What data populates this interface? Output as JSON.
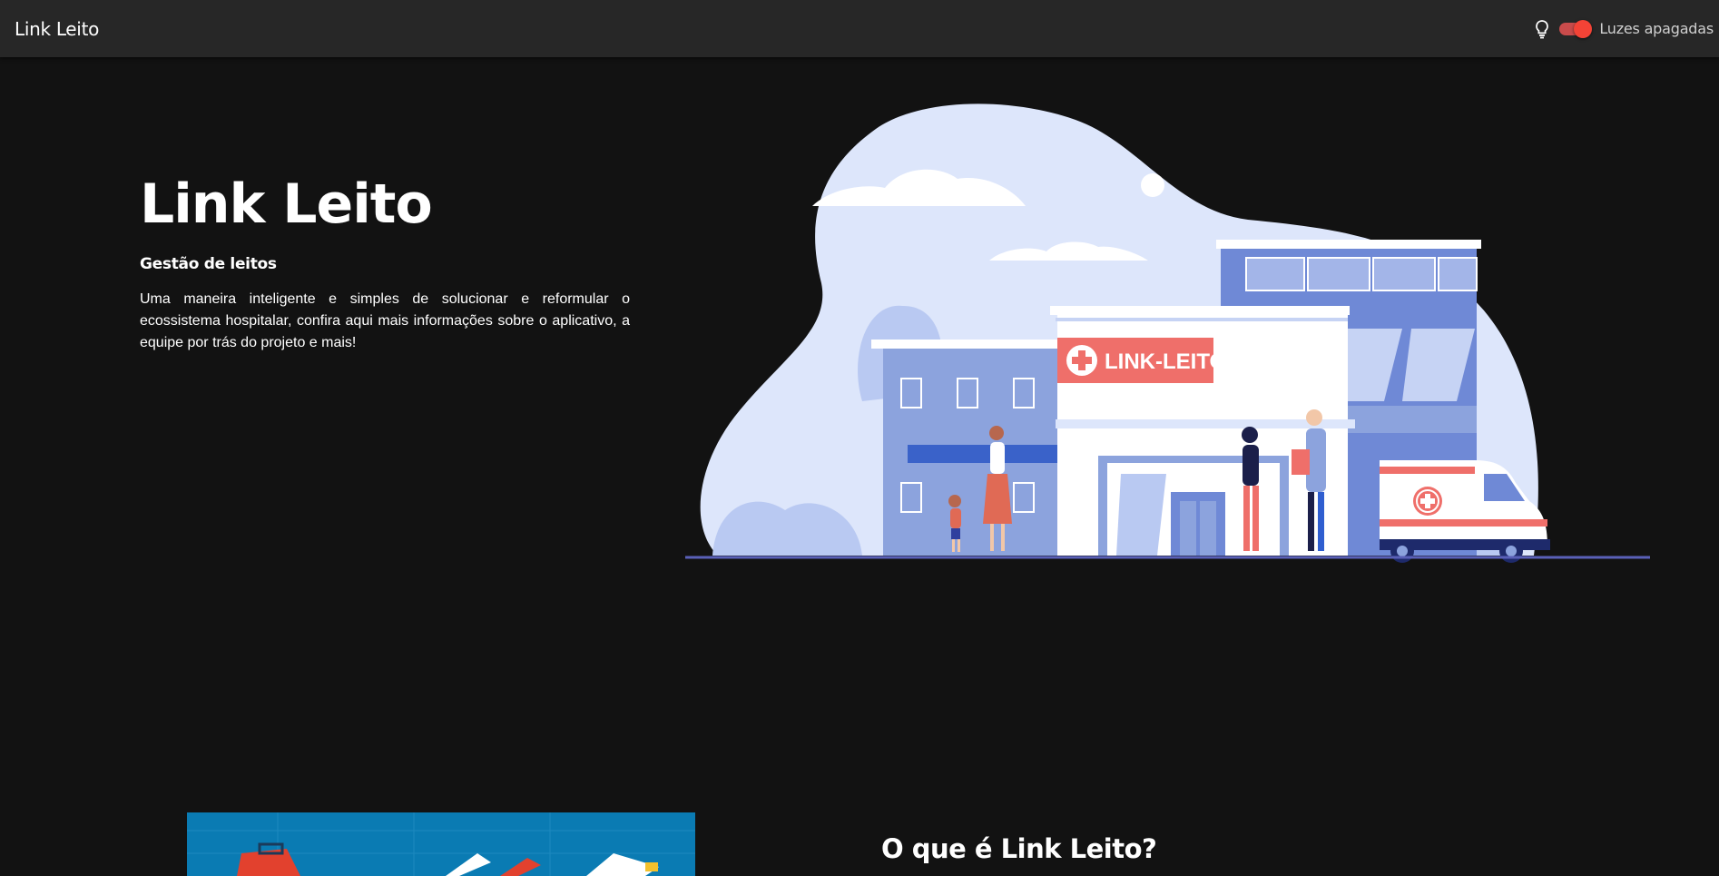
{
  "navbar": {
    "brand": "Link Leito",
    "theme_icon": "lightbulb-icon",
    "theme_toggle_state": "on",
    "theme_label": "Luzes apagadas"
  },
  "hero": {
    "title": "Link Leito",
    "subtitle": "Gestão de leitos",
    "description": "Uma maneira inteligente e simples de solucionar e reformular o ecossistema hospitalar, confira aqui mais informações sobre o aplicativo, a equipe por trás do projeto e mais!",
    "illustration_sign": "LINK-LEITO"
  },
  "about": {
    "title": "O que é Link Leito?"
  },
  "colors": {
    "background": "#121212",
    "navbar": "#272727",
    "toggle_accent": "#f44336",
    "blob": "#dde6fb",
    "building_blue": "#6f89d6",
    "sign_red": "#ef6f6a",
    "section_image_blue": "#0a7bb3"
  }
}
